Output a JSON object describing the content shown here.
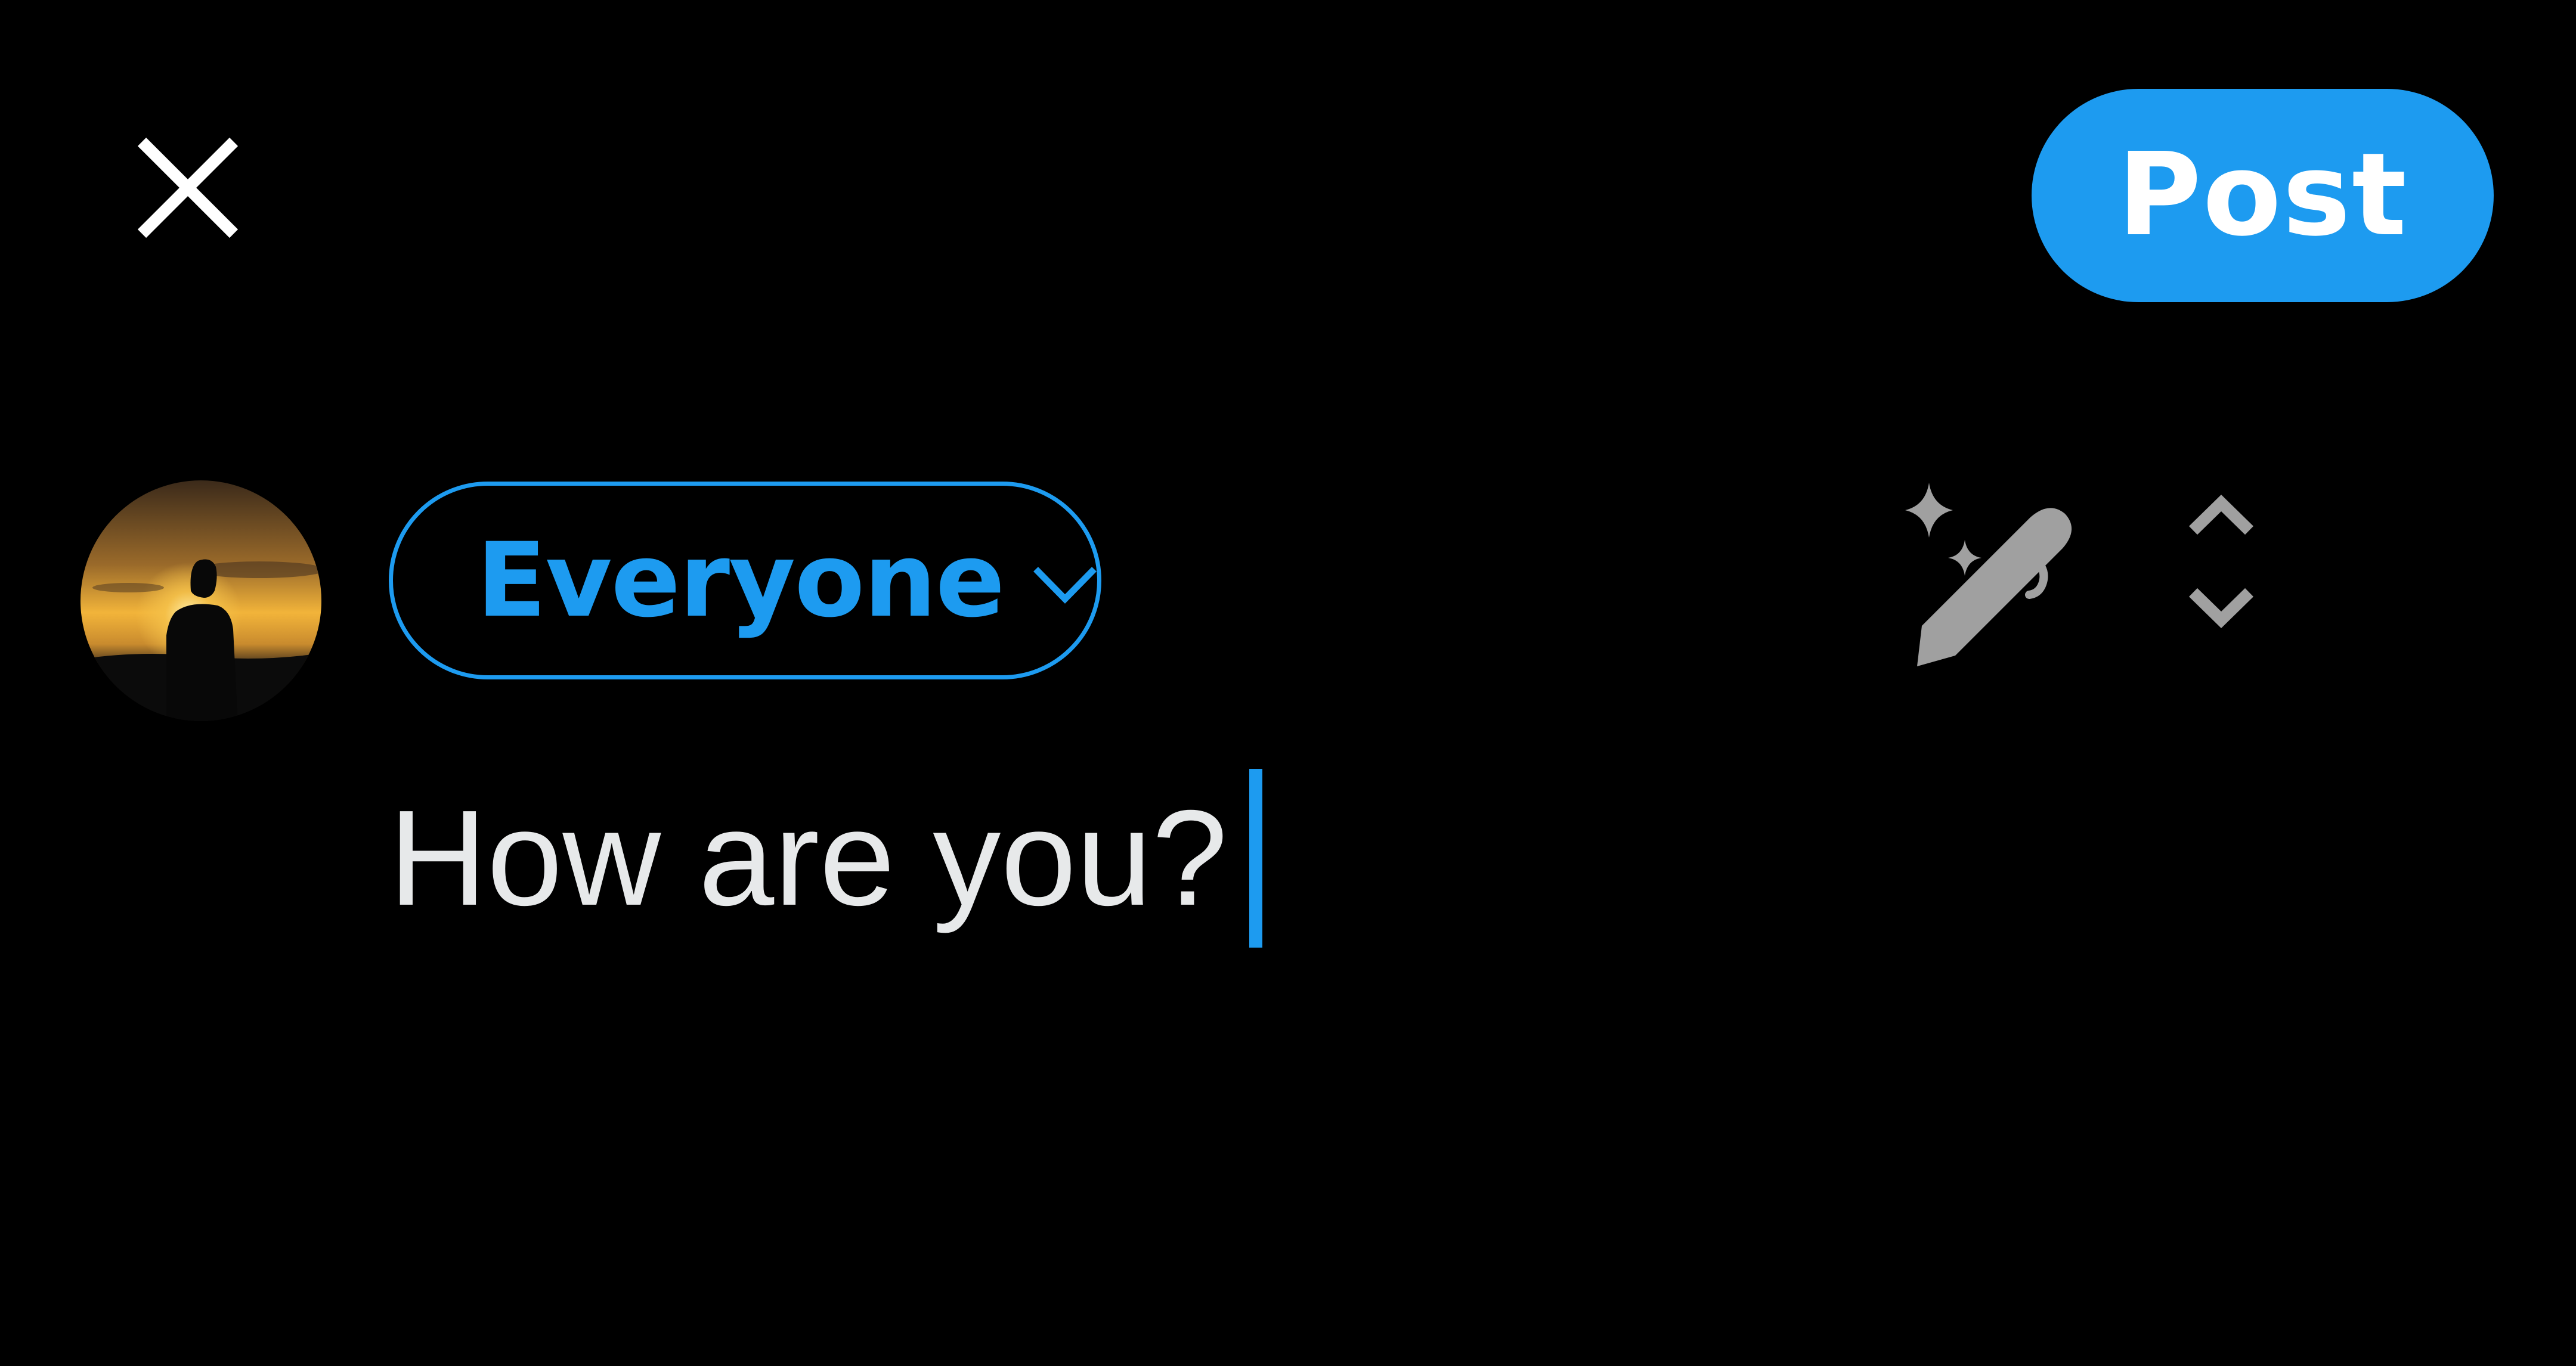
{
  "header": {
    "close_icon": "close-icon",
    "post_label": "Post"
  },
  "composer": {
    "avatar": "avatar",
    "audience_label": "Everyone",
    "audience_icon": "chevron-down-icon",
    "text_value": "How are you?",
    "tools": {
      "ai_write_icon": "sparkle-pen-icon",
      "expand_icon": "expand-collapse-icon"
    }
  },
  "colors": {
    "background": "#000000",
    "accent": "#1D9BF0",
    "text": "#E7E9EA",
    "icon_muted": "#A0A0A0"
  }
}
